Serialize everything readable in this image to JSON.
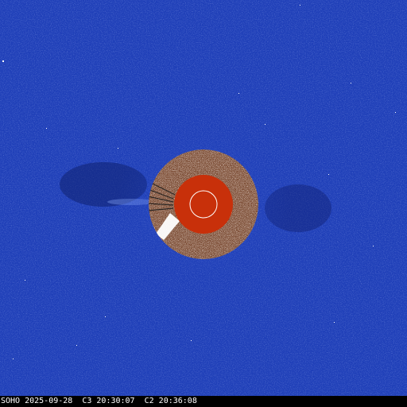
{
  "image": {
    "caption": "SOHO 2025-09-28  C3 20:30:07  C2 20:36:08",
    "colors": {
      "background": "#1f3fb8",
      "background_dark": "#14298a",
      "occulter_disk": "#c8300a",
      "c2_field_base": "#7a4a32",
      "sun_outline": "#ffffff",
      "caption_bar": "#000000",
      "caption_text": "#ffffff"
    }
  }
}
